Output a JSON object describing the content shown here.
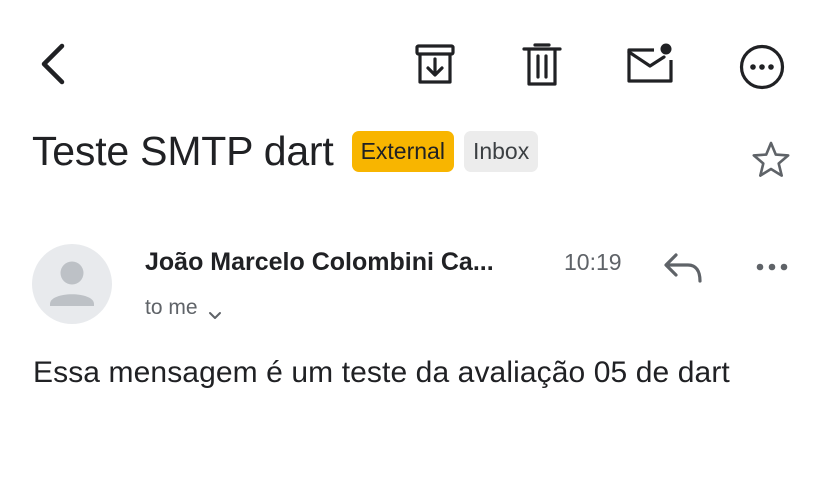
{
  "toolbar": {
    "icons": [
      "back-arrow-icon",
      "archive-icon",
      "trash-icon",
      "mark-unread-icon",
      "more-options-icon"
    ]
  },
  "email": {
    "subject": "Teste SMTP dart",
    "labels": [
      {
        "text": "External",
        "color": "#f8b500"
      },
      {
        "text": "Inbox",
        "color": "#ececec"
      }
    ],
    "starred": false,
    "sender": "João Marcelo Colombini Ca...",
    "time": "10:19",
    "recipient": "to me",
    "body": "Essa mensagem é um teste da avaliação 05 de dart"
  },
  "colors": {
    "text": "#202124",
    "secondary": "#5f6368",
    "external_label": "#f8b500",
    "inbox_label": "#ececec",
    "avatar_bg": "#e8eaed",
    "avatar_fg": "#bdc1c6"
  }
}
